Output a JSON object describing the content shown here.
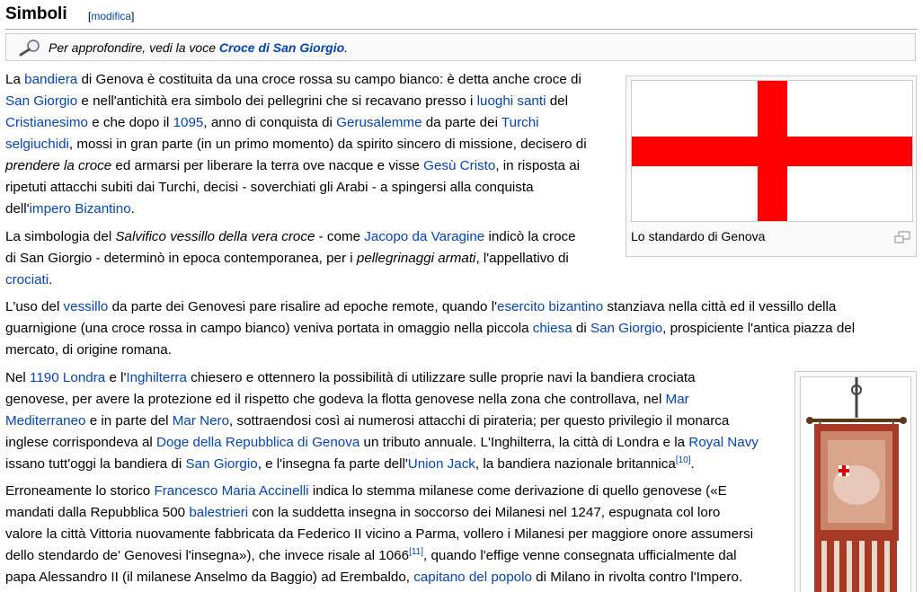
{
  "section": {
    "title": "Simboli",
    "edit_bracket_open": "[",
    "edit_label": "modifica",
    "edit_bracket_close": "]"
  },
  "hatnote": {
    "prefix": "Per approfondire, vedi la voce ",
    "link": "Croce di San Giorgio",
    "suffix": "."
  },
  "figure1": {
    "caption": "Lo standardo di Genova"
  },
  "p1": {
    "t1": "La ",
    "l1": "bandiera",
    "t2": " di Genova è costituita da una croce rossa su campo bianco: è detta anche croce di",
    "l2": "San Giorgio",
    "t3": " e nell'antichità era simbolo dei pellegrini che si recavano presso i ",
    "l3": "luoghi santi",
    "t4": " del",
    "l4": "Cristianesimo",
    "t5": " e che dopo il ",
    "l5": "1095",
    "t6": ", anno di conquista di ",
    "l6": "Gerusalemme",
    "t7": " da parte dei ",
    "l7": "Turchi",
    "l8": "selgiuchidi",
    "t8": ", mossi in gran parte (in un primo momento) da spirito sincero di missione, decisero di",
    "i1": "prendere la croce",
    "t9": " ed armarsi per liberare la terra ove nacque e visse ",
    "l9": "Gesù Cristo",
    "t10": ", in risposta ai",
    "t11": "ripetuti attacchi subiti dai Turchi, decisi - soverchiati gli Arabi - a spingersi alla conquista",
    "t12": "dell'",
    "l10": "impero Bizantino",
    "t13": "."
  },
  "p2": {
    "t1": "La simbologia del ",
    "i1": "Salvifico vessillo della vera croce",
    "t2": " - come ",
    "l1": "Jacopo da Varagine",
    "t3": " indicò la croce",
    "t4": "di San Giorgio - determinò in epoca contemporanea, per i ",
    "i2": "pellegrinaggi armati",
    "t5": ", l'appellativo di",
    "l2": "crociati",
    "t6": "."
  },
  "p3": {
    "t1": "L'uso del ",
    "l1": "vessillo",
    "t2": " da parte dei Genovesi pare risalire ad epoche remote, quando l'",
    "l2": "esercito bizantino",
    "t3": " stanziava nella città ed il vessillo della",
    "t4": "guarnigione (una croce rossa in campo bianco) veniva portata in omaggio nella piccola ",
    "l3": "chiesa",
    "t5": " di ",
    "l4": "San Giorgio",
    "t6": ", prospiciente l'antica piazza del",
    "t7": "mercato, di origine romana."
  },
  "p4": {
    "t1": "Nel ",
    "l1": "1190",
    "t2": " ",
    "l2": "Londra",
    "t3": " e l'",
    "l3": "Inghilterra",
    "t4": " chiesero e ottennero la possibilità di utilizzare sulle proprie navi la bandiera crociata",
    "t5": "genovese, per avere la protezione ed il rispetto che godeva la flotta genovese nella zona che controllava, nel ",
    "l4": "Mar",
    "l5": "Mediterraneo",
    "t6": " e in parte del ",
    "l6": "Mar Nero",
    "t7": ", sottraendosi così ai numerosi attacchi di pirateria; per questo privilegio il monarca",
    "t8": "inglese corrispondeva al ",
    "l7": "Doge della Repubblica di Genova",
    "t9": " un tributo annuale. L'Inghilterra, la città di Londra e la ",
    "l8": "Royal Navy",
    "t10": "issano tutt'oggi la bandiera di ",
    "l9": "San Giorgio",
    "t11": ", e l'insegna fa parte dell'",
    "l10": "Union Jack",
    "t12": ", la bandiera nazionale britannica",
    "ref": "[10]",
    "t13": "."
  },
  "p5": {
    "t1": "Erroneamente lo storico ",
    "l1": "Francesco Maria Accinelli",
    "t2": " indica lo stemma milanese come derivazione di quello genovese («E",
    "t3": "mandati dalla Repubblica 500 ",
    "l2": "balestrieri",
    "t4": " con la suddetta insegna in soccorso dei Milanesi nel 1247, espugnata col loro",
    "t5": "valore la città Vittoria nuovamente fabbricata da Federico II vicino a Parma, vollero i Milanesi per maggiore onore assumersi",
    "t6": "dello stendardo de' Genovesi l'insegna»), che invece risale al 1066",
    "ref": "[11]",
    "t7": ", quando l'effige venne consegnata ufficialmente dal",
    "t8": "papa Alessandro II (il milanese Anselmo da Baggio) ad Erembaldo, ",
    "l3": "capitano del popolo",
    "t9": " di Milano in rivolta contro l'Impero."
  }
}
